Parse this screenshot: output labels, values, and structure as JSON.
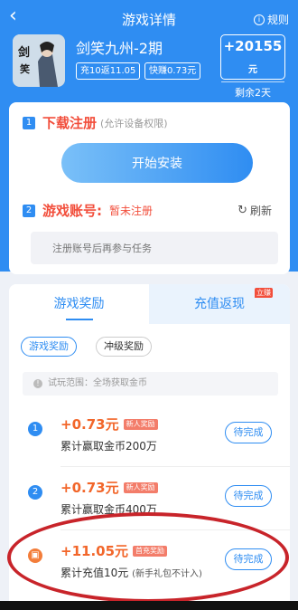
{
  "nav": {
    "back_icon": "chevron-left-icon",
    "title": "游戏详情",
    "rules_label": "规则"
  },
  "game": {
    "name": "剑笑九州-2期",
    "tags": [
      "充10返11.05",
      "快赚0.73元"
    ],
    "reward_amount": "+20155",
    "reward_unit": "元",
    "remaining": "剩余2天",
    "icon_text": "剑笑九州"
  },
  "steps": {
    "download": {
      "num": "1",
      "label": "下载注册",
      "hint": "(允许设备权限)",
      "button": "开始安装"
    },
    "account": {
      "num": "2",
      "label": "游戏账号:",
      "status": "暂未注册",
      "refresh": "刷新",
      "placeholder": "注册账号后再参与任务"
    }
  },
  "tabs": {
    "left": "游戏奖励",
    "right": "充值返现",
    "hot_badge": "立赚"
  },
  "filters": [
    "游戏奖励",
    "冲级奖励"
  ],
  "scope": "试玩范围：全场获取金币",
  "tasks": [
    {
      "num": "1",
      "amount": "+0.73元",
      "badge": "新人奖励",
      "desc": "累计赢取金币200万",
      "note": "",
      "button": "待完成"
    },
    {
      "num": "2",
      "amount": "+0.73元",
      "badge": "新人奖励",
      "desc": "累计赢取金币400万",
      "note": "",
      "button": "待完成"
    },
    {
      "num": "",
      "amount": "+11.05元",
      "badge": "首充奖励",
      "desc": "累计充值10元",
      "note": "(新手礼包不计入)",
      "button": "待完成"
    }
  ],
  "colors": {
    "primary": "#2f8df2",
    "accent": "#f24e3b",
    "money": "#f2662a",
    "highlight": "#c8242a"
  }
}
